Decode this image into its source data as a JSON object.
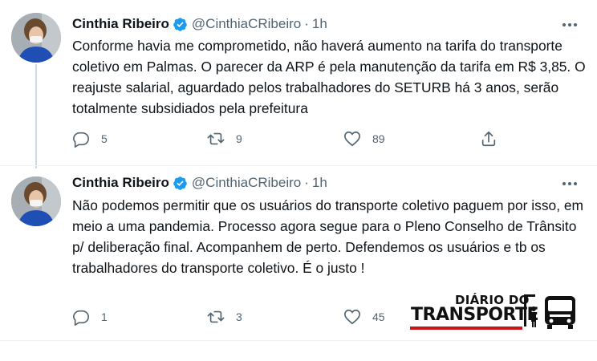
{
  "tweets": [
    {
      "name": "Cinthia Ribeiro",
      "handle": "@CinthiaCRibeiro",
      "separator": "·",
      "time": "1h",
      "text": "Conforme havia me comprometido, não haverá aumento na tarifa do transporte coletivo em Palmas. O parecer da ARP é pela manutenção da tarifa em R$ 3,85. O reajuste salarial, aguardado pelos trabalhadores do SETURB há 3 anos, serão totalmente subsidiados pela prefeitura",
      "replies": "5",
      "retweets": "9",
      "likes": "89"
    },
    {
      "name": "Cinthia Ribeiro",
      "handle": "@CinthiaCRibeiro",
      "separator": "·",
      "time": "1h",
      "text": "Não podemos permitir que os usuários do transporte coletivo paguem por isso, em meio a uma pandemia. Processo agora segue para o Pleno Conselho de Trânsito p/ deliberação final. Acompanhem de perto. Defendemos os usuários e tb os trabalhadores do transporte coletivo. É o justo !",
      "replies": "1",
      "retweets": "3",
      "likes": "45"
    }
  ],
  "watermark": {
    "line1": "DIÁRIO DO",
    "line2": "TRANSPORTE",
    "accent_color": "#c9141a"
  },
  "colors": {
    "verified": "#1d9bf0",
    "secondary_text": "#536471"
  },
  "icons": [
    "reply-icon",
    "retweet-icon",
    "like-icon",
    "share-icon",
    "verified-badge-icon",
    "more-options-icon"
  ]
}
